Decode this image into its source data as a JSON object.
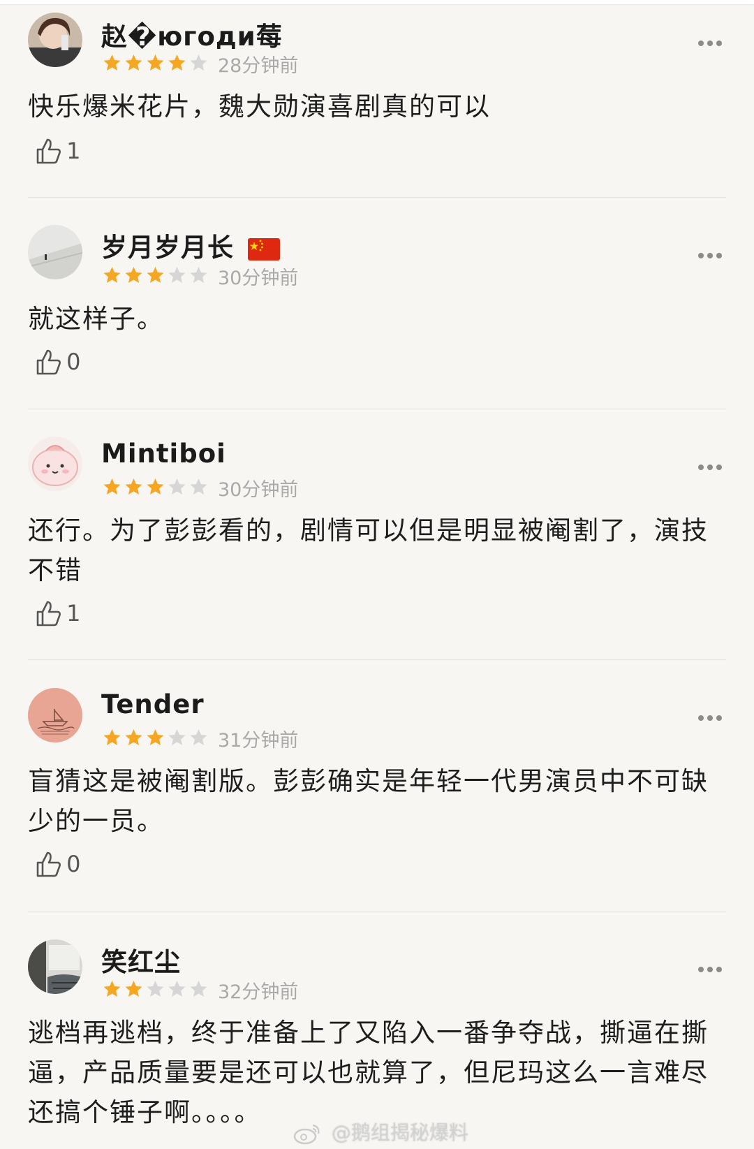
{
  "reviews": [
    {
      "user": "赵�югоди莓",
      "rating": 4,
      "time": "28分钟前",
      "text": "快乐爆米花片，魏大勋演喜剧真的可以",
      "likes": "1"
    },
    {
      "user": "岁月岁月长",
      "badge": "china-flag-icon",
      "rating": 3,
      "time": "30分钟前",
      "text": "就这样子。",
      "likes": "0"
    },
    {
      "user": "Mintiboi",
      "rating": 3,
      "time": "30分钟前",
      "text": "还行。为了彭彭看的，剧情可以但是明显被阉割了，演技不错",
      "likes": "1"
    },
    {
      "user": "Tender",
      "rating": 3,
      "time": "31分钟前",
      "text": "盲猜这是被阉割版。彭彭确实是年轻一代男演员中不可缺少的一员。",
      "likes": "0"
    },
    {
      "user": "笑红尘",
      "rating": 2,
      "time": "32分钟前",
      "text": "逃档再逃档，终于准备上了又陷入一番争夺战，撕逼在撕逼，产品质量要是还可以也就算了，但尼玛这么一言难尽还搞个锤子啊。。。。",
      "likes": ""
    }
  ],
  "watermark": "@鹅组揭秘爆料",
  "colors": {
    "star_filled": "#f5a623",
    "star_empty": "#d6d6d6",
    "time": "#a9a9a9",
    "background": "#f7f6f3"
  }
}
